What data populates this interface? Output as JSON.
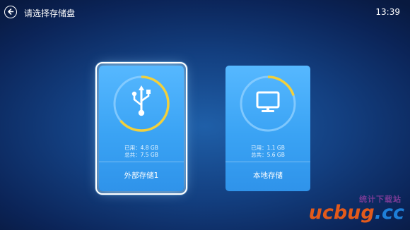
{
  "header": {
    "title": "请选择存储盘",
    "time": "13:39"
  },
  "storage_cards": [
    {
      "name": "外部存储1",
      "used_line": "已用：4.8 GB",
      "total_line": "总共：7.5 GB",
      "used_fraction": 0.64,
      "icon": "usb-icon",
      "selected": true
    },
    {
      "name": "本地存储",
      "used_line": "已用：1.1 GB",
      "total_line": "总共：5.6 GB",
      "used_fraction": 0.2,
      "icon": "monitor-icon",
      "selected": false
    }
  ],
  "watermark": {
    "small": "统计下载站",
    "big_part1": "ucbug",
    "big_part2": ".cc"
  },
  "colors": {
    "card": "#3aa3f4",
    "ring_used": "#f2d03b",
    "ring_track": "#8fd0ff"
  }
}
